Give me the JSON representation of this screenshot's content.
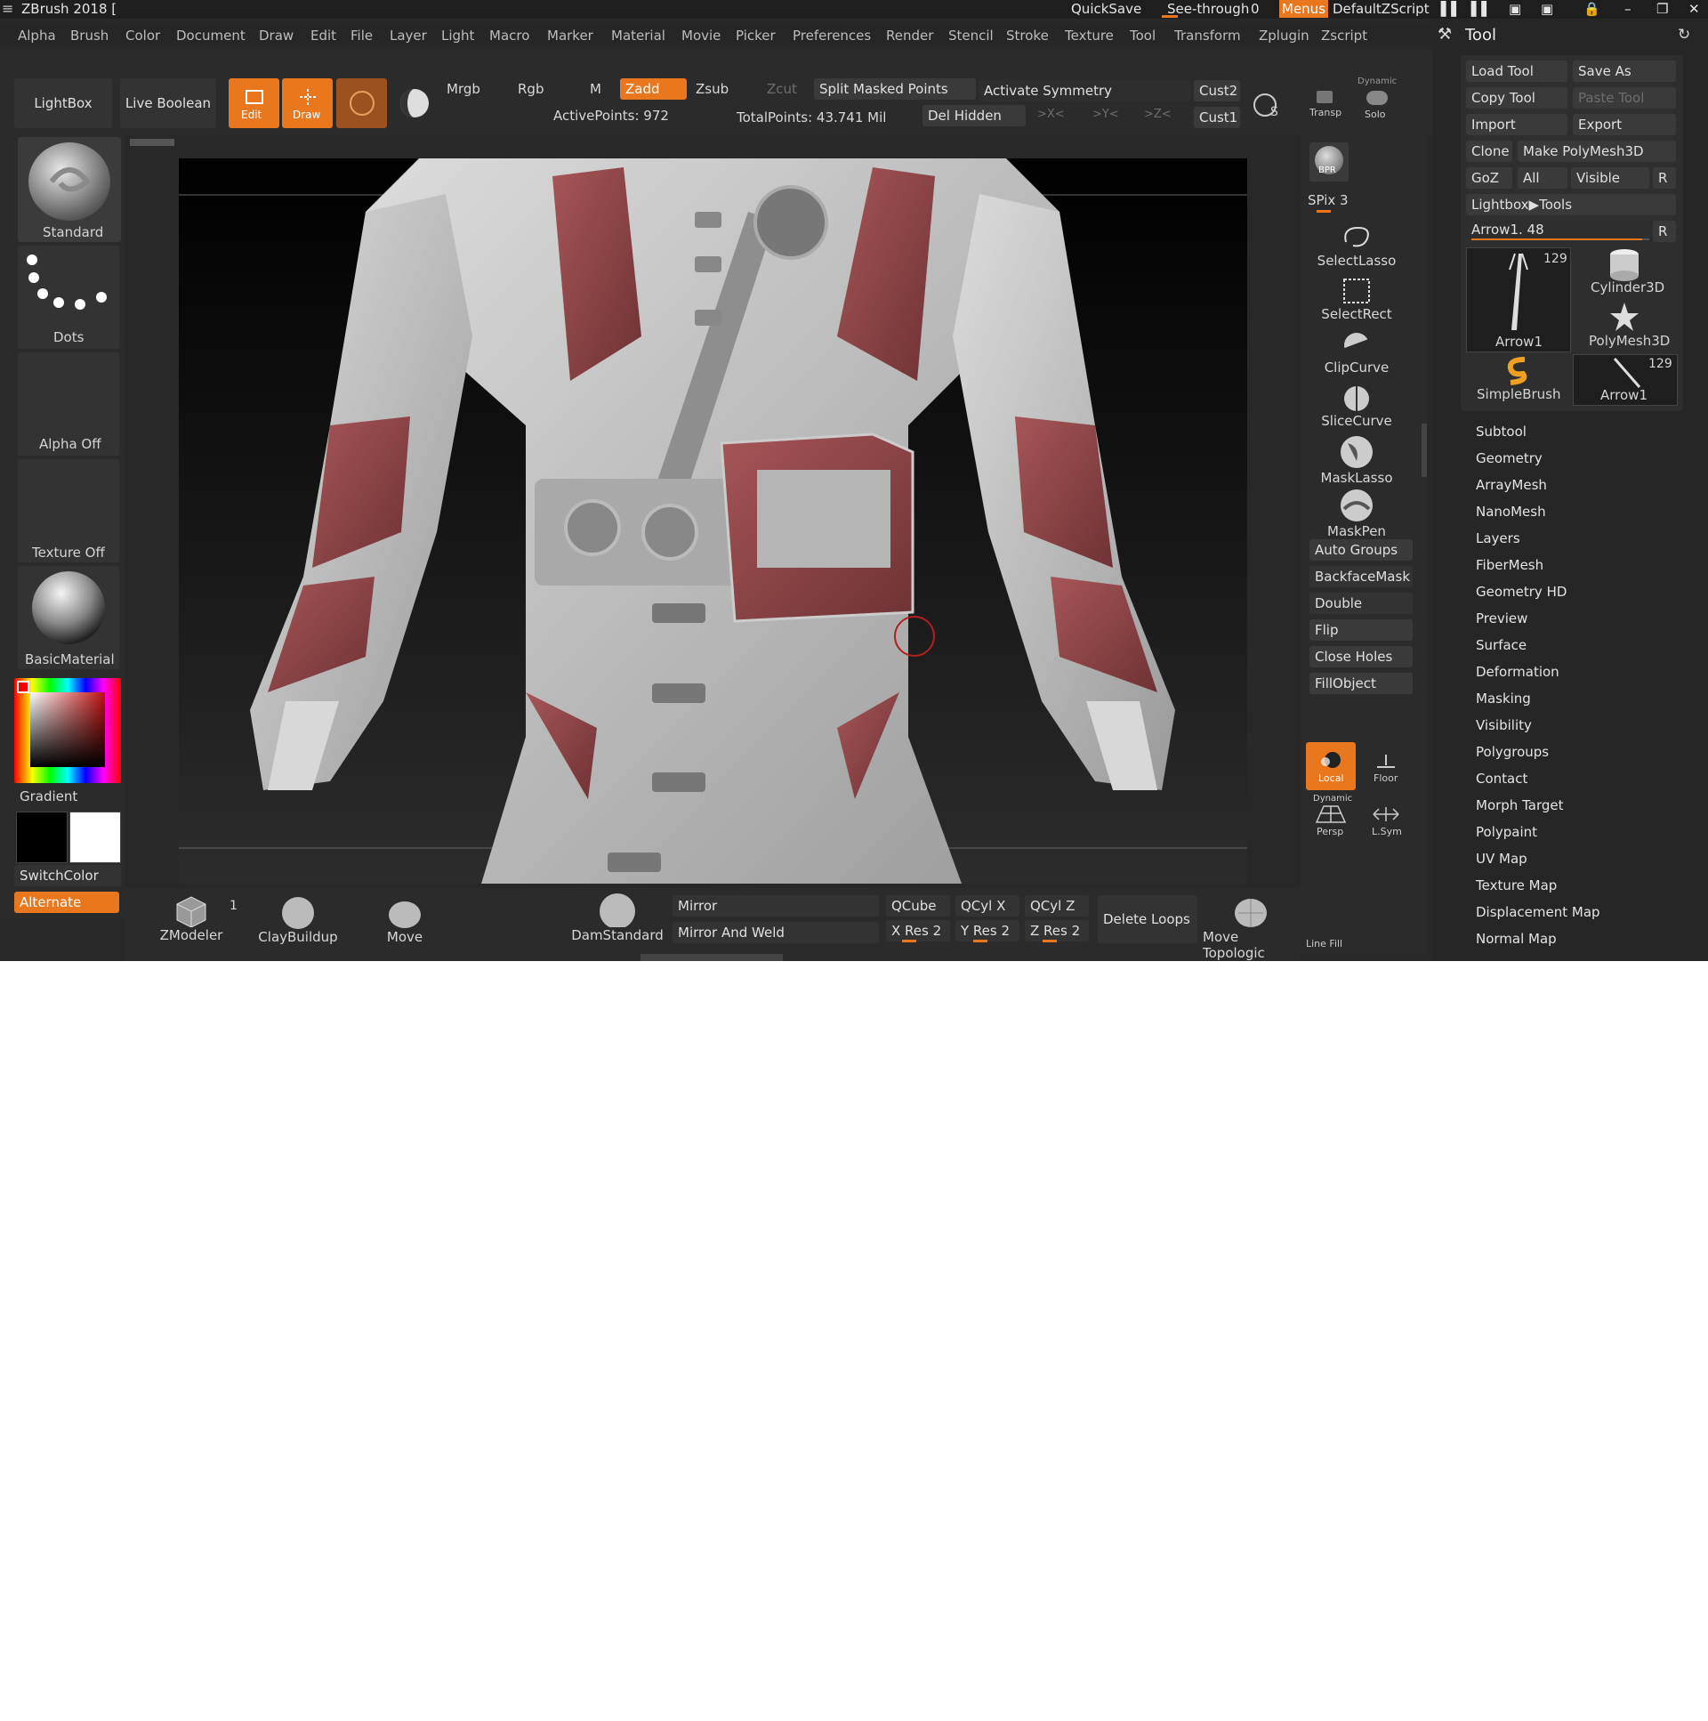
{
  "window": {
    "title": "ZBrush 2018 [",
    "quicksave": "QuickSave",
    "see_through_label": "See-through",
    "see_through_value": "0",
    "menus_label": "Menus",
    "default_zscript": "DefaultZScript"
  },
  "menubar": [
    "Alpha",
    "Brush",
    "Color",
    "Document",
    "Draw",
    "Edit",
    "File",
    "Layer",
    "Light",
    "Macro",
    "Marker",
    "Material",
    "Movie",
    "Picker",
    "Preferences",
    "Render",
    "Stencil",
    "Stroke",
    "Texture",
    "Tool",
    "Transform",
    "Zplugin",
    "Zscript"
  ],
  "topshelf": {
    "lightbox": "LightBox",
    "live_boolean": "Live Boolean",
    "edit": "Edit",
    "draw": "Draw",
    "mrgb": "Mrgb",
    "rgb": "Rgb",
    "m": "M",
    "zadd": "Zadd",
    "zsub": "Zsub",
    "zcut": "Zcut",
    "split_masked": "Split Masked Points",
    "activate_symmetry": "Activate Symmetry",
    "cust2": "Cust2",
    "cust1": "Cust1",
    "active_points": "ActivePoints: 972",
    "total_points": "TotalPoints: 43.741 Mil",
    "del_hidden": "Del Hidden",
    "x_axis": ">X<",
    "y_axis": ">Y<",
    "z_axis": ">Z<",
    "transp": "Transp",
    "dynamic": "Dynamic",
    "solo": "Solo"
  },
  "leftshelf": {
    "standard": "Standard",
    "dots": "Dots",
    "alpha_off": "Alpha Off",
    "texture_off": "Texture Off",
    "basic_material": "BasicMaterial",
    "gradient": "Gradient",
    "switch_color": "SwitchColor",
    "alternate": "Alternate"
  },
  "rightshelf": {
    "bpr": "BPR",
    "spix": "SPix 3",
    "select_lasso": "SelectLasso",
    "select_rect": "SelectRect",
    "clip_curve": "ClipCurve",
    "slice_curve": "SliceCurve",
    "mask_lasso": "MaskLasso",
    "mask_pen": "MaskPen",
    "auto_groups": "Auto Groups",
    "backface_mask": "BackfaceMask",
    "double": "Double",
    "flip": "Flip",
    "close_holes": "Close Holes",
    "fill_object": "FillObject",
    "local": "Local",
    "floor": "Floor",
    "dynamic": "Dynamic",
    "persp": "Persp",
    "lsym": "L.Sym",
    "line_fill": "Line Fill"
  },
  "bottomshelf": {
    "zmodeler": "ZModeler",
    "zmodeler_count": "1",
    "claybuildup": "ClayBuildup",
    "move": "Move",
    "damstandard": "DamStandard",
    "mirror": "Mirror",
    "mirror_weld": "Mirror And Weld",
    "qcube": "QCube",
    "qcylx": "QCyl X",
    "qcylz": "QCyl Z",
    "xres": "X Res 2",
    "yres": "Y Res 2",
    "zres": "Z Res 2",
    "delete_loops": "Delete Loops",
    "move_topologic": "Move Topologic"
  },
  "tool_palette": {
    "title": "Tool",
    "load_tool": "Load Tool",
    "save_as": "Save As",
    "copy_tool": "Copy Tool",
    "paste_tool": "Paste Tool",
    "import": "Import",
    "export": "Export",
    "clone": "Clone",
    "make_polymesh": "Make PolyMesh3D",
    "goz": "GoZ",
    "all": "All",
    "visible": "Visible",
    "r": "R",
    "lightbox_tools": "Lightbox▶Tools",
    "arrow_slider": "Arrow1. 48",
    "slider_fraction": 0.96,
    "thumbs": [
      {
        "name": "Arrow1",
        "count": "129"
      },
      {
        "name": "Cylinder3D",
        "count": ""
      },
      {
        "name": "PolyMesh3D",
        "count": ""
      },
      {
        "name": "SimpleBrush",
        "count": ""
      },
      {
        "name": "Arrow1",
        "count": "129"
      }
    ],
    "sections": [
      "Subtool",
      "Geometry",
      "ArrayMesh",
      "NanoMesh",
      "Layers",
      "FiberMesh",
      "Geometry HD",
      "Preview",
      "Surface",
      "Deformation",
      "Masking",
      "Visibility",
      "Polygroups",
      "Contact",
      "Morph Target",
      "Polypaint",
      "UV Map",
      "Texture Map",
      "Displacement Map",
      "Normal Map"
    ]
  },
  "colors": {
    "accent": "#e8771e",
    "background": "#282828",
    "panel": "#303030",
    "model_red": "#8b4446",
    "model_white": "#c9c9c9"
  }
}
